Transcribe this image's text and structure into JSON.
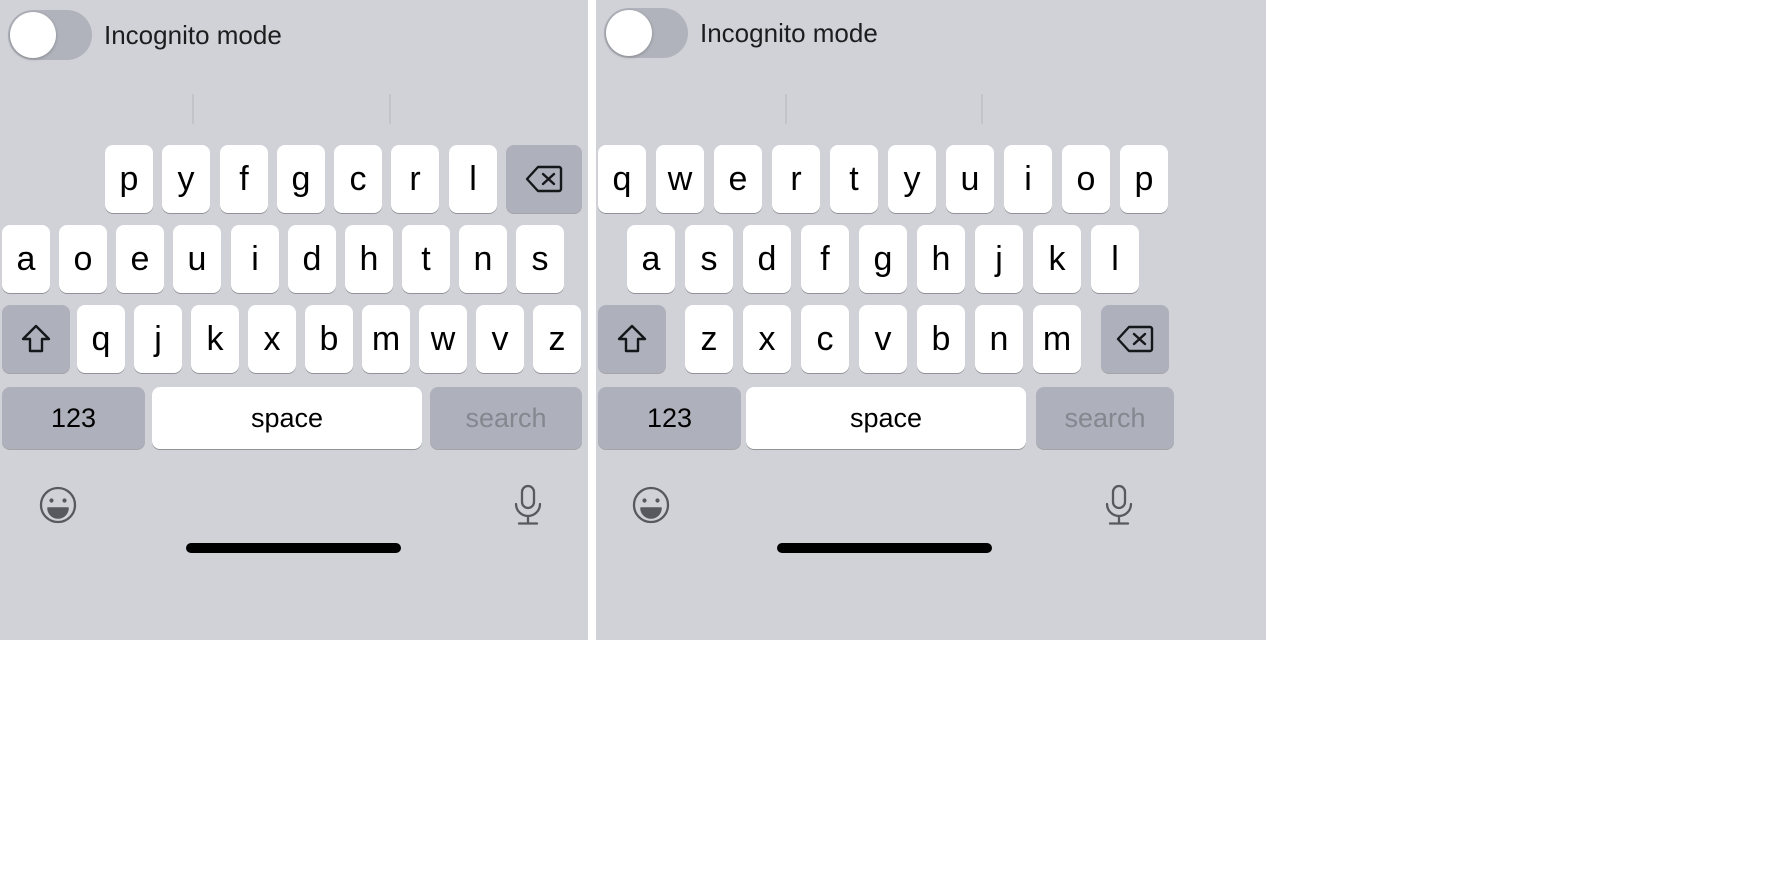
{
  "screen": {
    "background": "#ffffff",
    "panel_background": "#d1d2d8",
    "key_background": "#ffffff",
    "modifier_key_background": "#aeb1bb",
    "key_text_color": "#000000",
    "muted_text_color": "#85878f"
  },
  "panels": [
    {
      "id": "left",
      "layout_name": "dvorak",
      "toggle": {
        "label": "Incognito mode",
        "state": "off"
      },
      "keyboard": {
        "rows": [
          {
            "id": "row-1",
            "keys": [
              {
                "label": "p",
                "type": "letter"
              },
              {
                "label": "y",
                "type": "letter"
              },
              {
                "label": "f",
                "type": "letter"
              },
              {
                "label": "g",
                "type": "letter"
              },
              {
                "label": "c",
                "type": "letter"
              },
              {
                "label": "r",
                "type": "letter"
              },
              {
                "label": "l",
                "type": "letter"
              },
              {
                "label": "",
                "type": "backspace",
                "icon": "backspace-icon"
              }
            ]
          },
          {
            "id": "row-2",
            "keys": [
              {
                "label": "a",
                "type": "letter"
              },
              {
                "label": "o",
                "type": "letter"
              },
              {
                "label": "e",
                "type": "letter"
              },
              {
                "label": "u",
                "type": "letter"
              },
              {
                "label": "i",
                "type": "letter"
              },
              {
                "label": "d",
                "type": "letter"
              },
              {
                "label": "h",
                "type": "letter"
              },
              {
                "label": "t",
                "type": "letter"
              },
              {
                "label": "n",
                "type": "letter"
              },
              {
                "label": "s",
                "type": "letter"
              }
            ]
          },
          {
            "id": "row-3",
            "keys": [
              {
                "label": "",
                "type": "shift",
                "icon": "shift-icon"
              },
              {
                "label": "q",
                "type": "letter"
              },
              {
                "label": "j",
                "type": "letter"
              },
              {
                "label": "k",
                "type": "letter"
              },
              {
                "label": "x",
                "type": "letter"
              },
              {
                "label": "b",
                "type": "letter"
              },
              {
                "label": "m",
                "type": "letter"
              },
              {
                "label": "w",
                "type": "letter"
              },
              {
                "label": "v",
                "type": "letter"
              },
              {
                "label": "z",
                "type": "letter"
              }
            ]
          },
          {
            "id": "row-4",
            "keys": [
              {
                "label": "123",
                "type": "numeric"
              },
              {
                "label": "space",
                "type": "space"
              },
              {
                "label": "search",
                "type": "return"
              }
            ]
          }
        ],
        "utility_icons": [
          {
            "name": "emoji-icon",
            "label": "emoji"
          },
          {
            "name": "microphone-icon",
            "label": "dictation"
          }
        ]
      }
    },
    {
      "id": "right",
      "layout_name": "qwerty",
      "toggle": {
        "label": "Incognito mode",
        "state": "off"
      },
      "keyboard": {
        "rows": [
          {
            "id": "row-1",
            "keys": [
              {
                "label": "q",
                "type": "letter"
              },
              {
                "label": "w",
                "type": "letter"
              },
              {
                "label": "e",
                "type": "letter"
              },
              {
                "label": "r",
                "type": "letter"
              },
              {
                "label": "t",
                "type": "letter"
              },
              {
                "label": "y",
                "type": "letter"
              },
              {
                "label": "u",
                "type": "letter"
              },
              {
                "label": "i",
                "type": "letter"
              },
              {
                "label": "o",
                "type": "letter"
              },
              {
                "label": "p",
                "type": "letter"
              }
            ]
          },
          {
            "id": "row-2",
            "keys": [
              {
                "label": "a",
                "type": "letter"
              },
              {
                "label": "s",
                "type": "letter"
              },
              {
                "label": "d",
                "type": "letter"
              },
              {
                "label": "f",
                "type": "letter"
              },
              {
                "label": "g",
                "type": "letter"
              },
              {
                "label": "h",
                "type": "letter"
              },
              {
                "label": "j",
                "type": "letter"
              },
              {
                "label": "k",
                "type": "letter"
              },
              {
                "label": "l",
                "type": "letter"
              }
            ]
          },
          {
            "id": "row-3",
            "keys": [
              {
                "label": "",
                "type": "shift",
                "icon": "shift-icon"
              },
              {
                "label": "z",
                "type": "letter"
              },
              {
                "label": "x",
                "type": "letter"
              },
              {
                "label": "c",
                "type": "letter"
              },
              {
                "label": "v",
                "type": "letter"
              },
              {
                "label": "b",
                "type": "letter"
              },
              {
                "label": "n",
                "type": "letter"
              },
              {
                "label": "m",
                "type": "letter"
              },
              {
                "label": "",
                "type": "backspace",
                "icon": "backspace-icon"
              }
            ]
          },
          {
            "id": "row-4",
            "keys": [
              {
                "label": "123",
                "type": "numeric"
              },
              {
                "label": "space",
                "type": "space"
              },
              {
                "label": "search",
                "type": "return"
              }
            ]
          }
        ],
        "utility_icons": [
          {
            "name": "emoji-icon",
            "label": "emoji"
          },
          {
            "name": "microphone-icon",
            "label": "dictation"
          }
        ]
      }
    }
  ]
}
